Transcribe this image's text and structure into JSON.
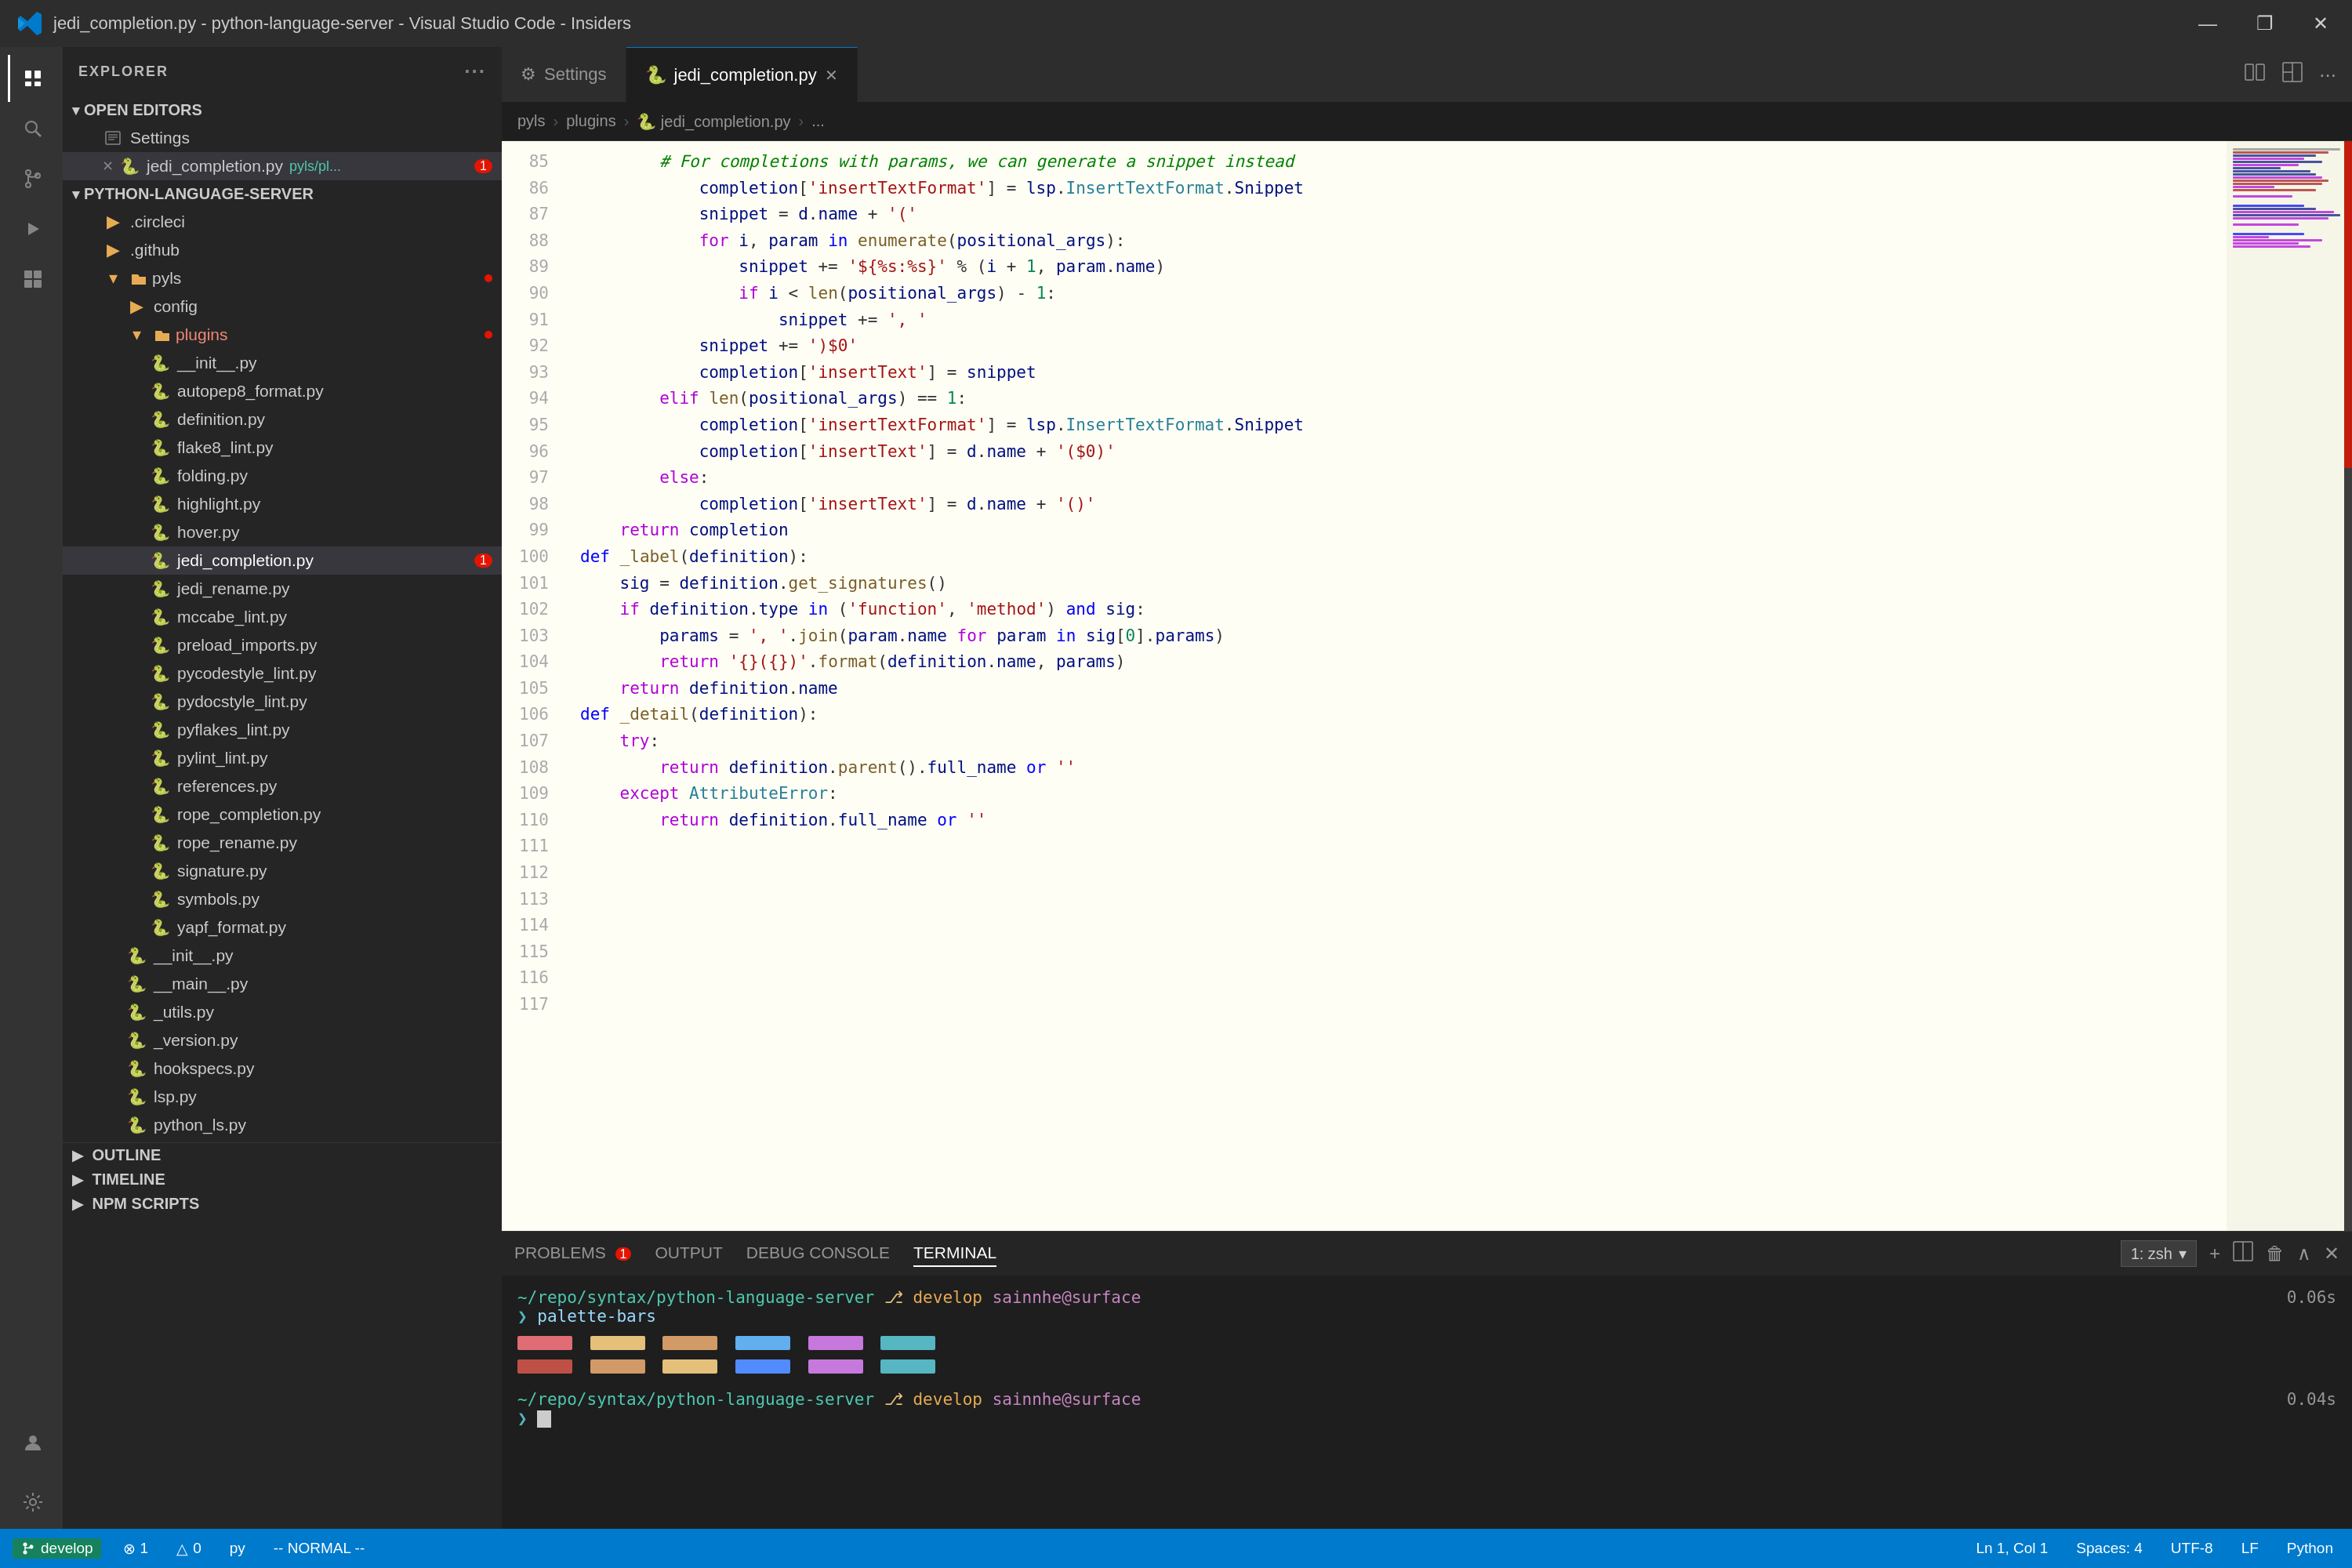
{
  "window": {
    "title": "jedi_completion.py - python-language-server - Visual Studio Code - Insiders"
  },
  "title_bar": {
    "title": "jedi_completion.py - python-language-server - Visual Studio Code - Insiders",
    "minimize": "—",
    "maximize": "❐",
    "close": "✕"
  },
  "tabs": [
    {
      "label": "Settings",
      "icon": "⚙",
      "active": false,
      "modified": false
    },
    {
      "label": "jedi_completion.py",
      "icon": "🐍",
      "active": true,
      "modified": true
    }
  ],
  "breadcrumb": {
    "parts": [
      "pyls",
      ">",
      "plugins",
      ">",
      "🐍 jedi_completion.py",
      ">",
      "..."
    ]
  },
  "sidebar": {
    "header": "EXPLORER",
    "sections": {
      "open_editors": "OPEN EDITORS",
      "python_language_server": "PYTHON-LANGUAGE-SERVER"
    },
    "open_editors": [
      {
        "name": "Settings",
        "icon": "file",
        "modified": false
      },
      {
        "name": "jedi_completion.py",
        "icon": "py",
        "modified": true,
        "badge": "1"
      }
    ],
    "tree": [
      {
        "name": ".circleci",
        "icon": "folder",
        "indent": 1
      },
      {
        "name": ".github",
        "icon": "folder",
        "indent": 1
      },
      {
        "name": "pyls",
        "icon": "folder-open",
        "indent": 1,
        "badge": "dot"
      },
      {
        "name": "config",
        "icon": "folder",
        "indent": 2
      },
      {
        "name": "plugins",
        "icon": "folder-open",
        "indent": 2,
        "badge": "dot"
      },
      {
        "name": "__init__.py",
        "icon": "py",
        "indent": 3
      },
      {
        "name": "autopep8_format.py",
        "icon": "py",
        "indent": 3
      },
      {
        "name": "definition.py",
        "icon": "py",
        "indent": 3
      },
      {
        "name": "flake8_lint.py",
        "icon": "py",
        "indent": 3
      },
      {
        "name": "folding.py",
        "icon": "py",
        "indent": 3
      },
      {
        "name": "highlight.py",
        "icon": "py",
        "indent": 3
      },
      {
        "name": "hover.py",
        "icon": "py",
        "indent": 3
      },
      {
        "name": "jedi_completion.py",
        "icon": "py",
        "indent": 3,
        "active": true,
        "badge": "1"
      },
      {
        "name": "jedi_rename.py",
        "icon": "py",
        "indent": 3
      },
      {
        "name": "mccabe_lint.py",
        "icon": "py",
        "indent": 3
      },
      {
        "name": "preload_imports.py",
        "icon": "py",
        "indent": 3
      },
      {
        "name": "pycodestyle_lint.py",
        "icon": "py",
        "indent": 3
      },
      {
        "name": "pydocstyle_lint.py",
        "icon": "py",
        "indent": 3
      },
      {
        "name": "pyflakes_lint.py",
        "icon": "py",
        "indent": 3
      },
      {
        "name": "pylint_lint.py",
        "icon": "py",
        "indent": 3
      },
      {
        "name": "references.py",
        "icon": "py",
        "indent": 3
      },
      {
        "name": "rope_completion.py",
        "icon": "py",
        "indent": 3
      },
      {
        "name": "rope_rename.py",
        "icon": "py",
        "indent": 3
      },
      {
        "name": "signature.py",
        "icon": "py",
        "indent": 3
      },
      {
        "name": "symbols.py",
        "icon": "py",
        "indent": 3
      },
      {
        "name": "yapf_format.py",
        "icon": "py",
        "indent": 3
      },
      {
        "name": "__init__.py",
        "icon": "py",
        "indent": 2
      },
      {
        "name": "__main__.py",
        "icon": "py",
        "indent": 2
      },
      {
        "name": "_utils.py",
        "icon": "py",
        "indent": 2
      },
      {
        "name": "_version.py",
        "icon": "py",
        "indent": 2
      },
      {
        "name": "hookspecs.py",
        "icon": "py",
        "indent": 2
      },
      {
        "name": "lsp.py",
        "icon": "py",
        "indent": 2
      },
      {
        "name": "python_ls.py",
        "icon": "py",
        "indent": 2
      }
    ],
    "bottom_sections": [
      "OUTLINE",
      "TIMELINE",
      "NPM SCRIPTS"
    ]
  },
  "code": {
    "lines": [
      "        # For completions with params, we can generate a snippet instead",
      "            completion['insertTextFormat'] = lsp.InsertTextFormat.Snippet",
      "            snippet = d.name + '('",
      "            for i, param in enumerate(positional_args):",
      "                snippet += '${%s:%s}' % (i + 1, param.name)",
      "                if i < len(positional_args) - 1:",
      "                    snippet += ', '",
      "            snippet += ')$0'",
      "            completion['insertText'] = snippet",
      "        elif len(positional_args) == 1:",
      "            completion['insertTextFormat'] = lsp.InsertTextFormat.Snippet",
      "            completion['insertText'] = d.name + '($0)'",
      "        else:",
      "            completion['insertText'] = d.name + '()'",
      "",
      "    return completion",
      "",
      "",
      "def _label(definition):",
      "    sig = definition.get_signatures()",
      "    if definition.type in ('function', 'method') and sig:",
      "        params = ', '.join(param.name for param in sig[0].params)",
      "        return '{}({})'.format(definition.name, params)",
      "",
      "    return definition.name",
      "",
      "",
      "def _detail(definition):",
      "    try:",
      "        return definition.parent().full_name or ''",
      "    except AttributeError:",
      "        return definition.full_name or ''"
    ],
    "line_start": 85
  },
  "panel": {
    "tabs": [
      "PROBLEMS",
      "OUTPUT",
      "DEBUG CONSOLE",
      "TERMINAL"
    ],
    "problems_badge": "1",
    "active_tab": "TERMINAL",
    "terminal_selector": "1: zsh",
    "terminal_content": [
      "~/repo/syntax/python-language-server  develop    0.06s sainnhe@surface",
      "> palette-bars",
      "",
      "~/repo/syntax/python-language-server  develop    0.04s sainnhe@surface",
      "> "
    ]
  },
  "status_bar": {
    "git": "develop",
    "errors": "⊗ 1",
    "warnings": "△ 0",
    "python": "py",
    "vim_mode": "-- NORMAL --",
    "position": "Ln 1, Col 1",
    "spaces": "Spaces: 4",
    "encoding": "UTF-8",
    "line_ending": "LF",
    "language": "Python"
  },
  "palette_colors": {
    "row1": [
      "#e06c75",
      "#e5c07b",
      "#d19a66",
      "#61afef",
      "#c678dd",
      "#56b6c2"
    ],
    "row2": [
      "#be5046",
      "#d19a66",
      "#e5c07b",
      "#528bff",
      "#c678dd",
      "#56b6c2"
    ]
  }
}
